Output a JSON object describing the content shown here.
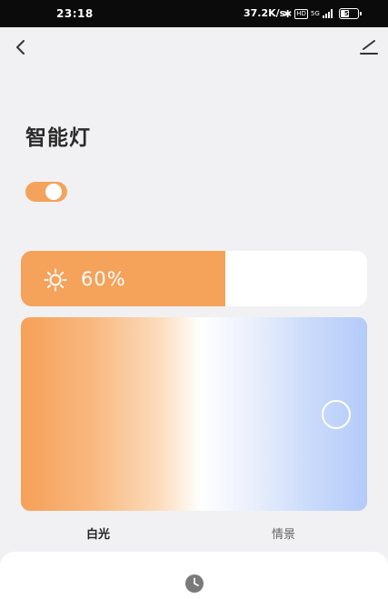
{
  "status_bar": {
    "time": "23:18",
    "net_speed": "37.2K/s",
    "bluetooth_icon": "bluetooth-icon",
    "hd_label": "HD",
    "network_type": "5G",
    "battery_level": "51"
  },
  "header": {
    "back_icon": "chevron-left-icon",
    "edit_icon": "pencil-icon"
  },
  "device": {
    "title": "智能灯",
    "power_on": true
  },
  "brightness": {
    "icon": "sun-icon",
    "label": "60%",
    "value": 0.6
  },
  "color_temperature": {
    "warm_color": "#f6a057",
    "neutral_color": "#ffffff",
    "cool_color": "#b4cbf9",
    "picker_position_fraction": 0.92
  },
  "tabs": [
    {
      "label": "白光",
      "active": true
    },
    {
      "label": "情景",
      "active": false
    }
  ],
  "bottom": {
    "icon": "clock-icon"
  },
  "colors": {
    "accent": "#f5a25a",
    "background": "#f1f1f3"
  }
}
